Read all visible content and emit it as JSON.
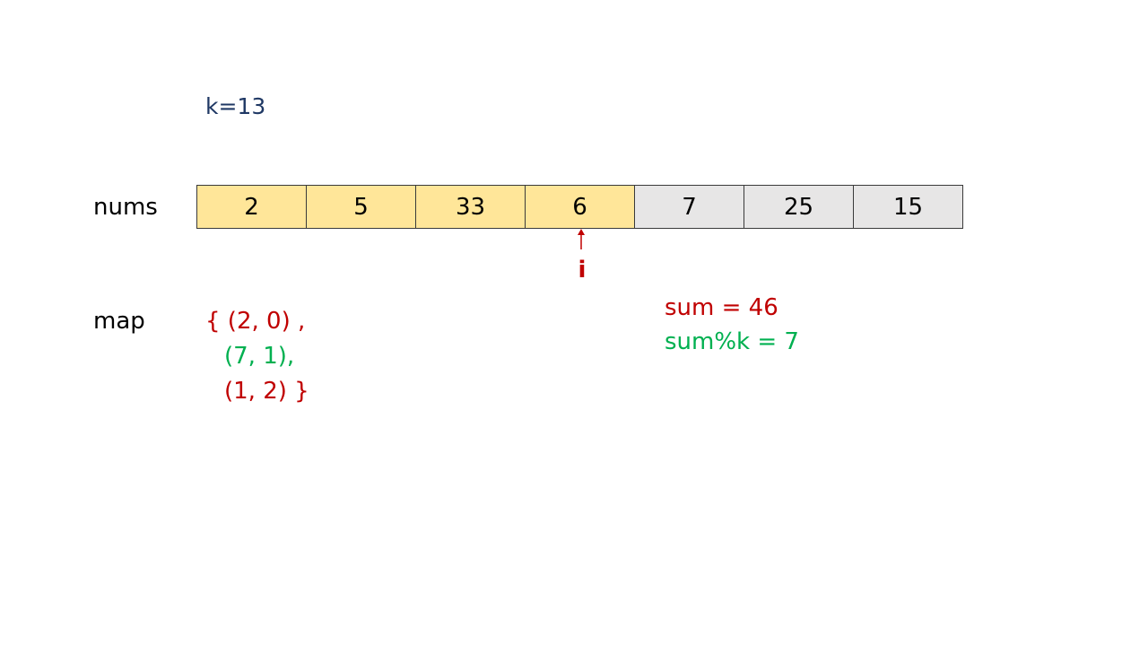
{
  "k_label": "k=13",
  "nums_label": "nums",
  "nums": [
    {
      "value": "2",
      "highlight": true
    },
    {
      "value": "5",
      "highlight": true
    },
    {
      "value": "33",
      "highlight": true
    },
    {
      "value": "6",
      "highlight": true
    },
    {
      "value": "7",
      "highlight": false
    },
    {
      "value": "25",
      "highlight": false
    },
    {
      "value": "15",
      "highlight": false
    }
  ],
  "pointer_label": "i",
  "map_label": "map",
  "map_lines": [
    "{ (2, 0) ,",
    "(7, 1),",
    "(1, 2) }"
  ],
  "sum_text": "sum = 46",
  "mod_text": "sum%k = 7",
  "colors": {
    "navy": "#1f3864",
    "red": "#c00000",
    "green": "#00b050",
    "highlight_cell": "#ffe699",
    "plain_cell": "#e7e6e6"
  }
}
